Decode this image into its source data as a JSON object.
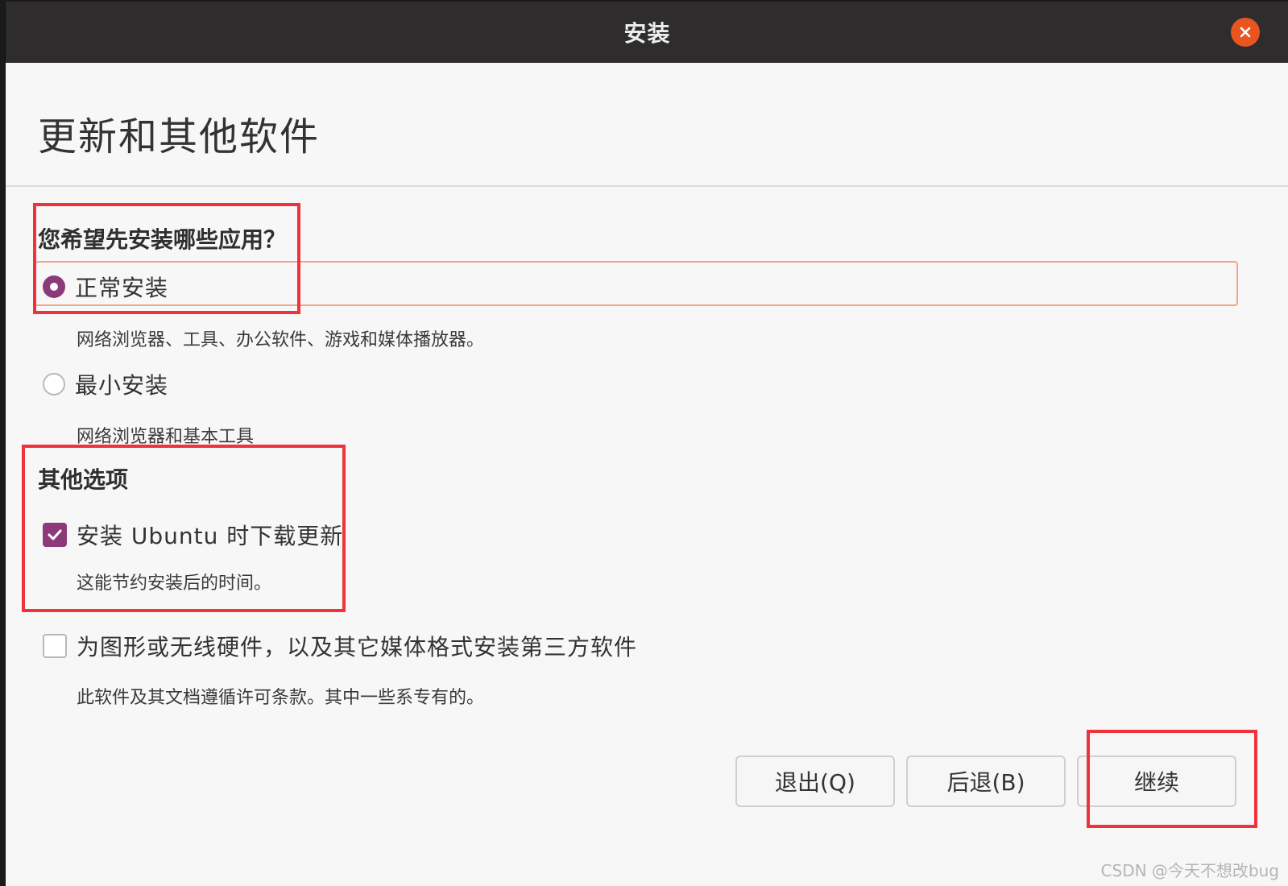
{
  "window": {
    "title": "安装",
    "close_icon": "close-icon"
  },
  "page": {
    "title": "更新和其他软件"
  },
  "apps_section": {
    "heading": "您希望先安装哪些应用？",
    "options": [
      {
        "label": "正常安装",
        "description": "网络浏览器、工具、办公软件、游戏和媒体播放器。",
        "selected": true
      },
      {
        "label": "最小安装",
        "description": "网络浏览器和基本工具",
        "selected": false
      }
    ]
  },
  "other_section": {
    "heading": "其他选项",
    "options": [
      {
        "label": "安装 Ubuntu 时下载更新",
        "description": "这能节约安装后的时间。",
        "checked": true
      },
      {
        "label": "为图形或无线硬件，以及其它媒体格式安装第三方软件",
        "description": "此软件及其文档遵循许可条款。其中一些系专有的。",
        "checked": false
      }
    ]
  },
  "buttons": {
    "quit": "退出(Q)",
    "back": "后退(B)",
    "continue": "继续"
  },
  "watermark": "CSDN @今天不想改bug",
  "colors": {
    "accent": "#8c3a7a",
    "close": "#e95420",
    "focus": "#f2a58a",
    "annotation": "#f0333a"
  }
}
